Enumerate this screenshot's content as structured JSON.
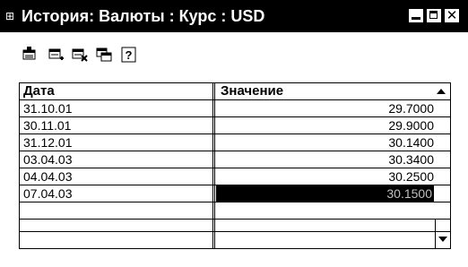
{
  "window": {
    "title": "История: Валюты : Курс : USD",
    "icon": "history-app-icon",
    "controls": {
      "minimize": "minimize-icon",
      "maximize": "maximize-icon",
      "close": "close-icon"
    }
  },
  "toolbar": {
    "buttons": [
      {
        "icon": "new-record-icon"
      },
      {
        "icon": "add-row-icon"
      },
      {
        "icon": "delete-row-icon"
      },
      {
        "icon": "copy-row-icon"
      },
      {
        "icon": "help-icon",
        "glyph": "?"
      }
    ]
  },
  "table": {
    "columns": [
      "Дата",
      "Значение"
    ],
    "sort_direction": "ascending",
    "rows": [
      {
        "date": "31.10.01",
        "value": "29.7000"
      },
      {
        "date": "30.11.01",
        "value": "29.9000"
      },
      {
        "date": "31.12.01",
        "value": "30.1400"
      },
      {
        "date": "03.04.03",
        "value": "30.3400"
      },
      {
        "date": "04.04.03",
        "value": "30.2500"
      },
      {
        "date": "07.04.03",
        "value": "30.1500"
      }
    ],
    "selected_row": 5,
    "colors": {
      "selection_bg": "#000000",
      "selection_text": "#c0c0c0"
    }
  }
}
